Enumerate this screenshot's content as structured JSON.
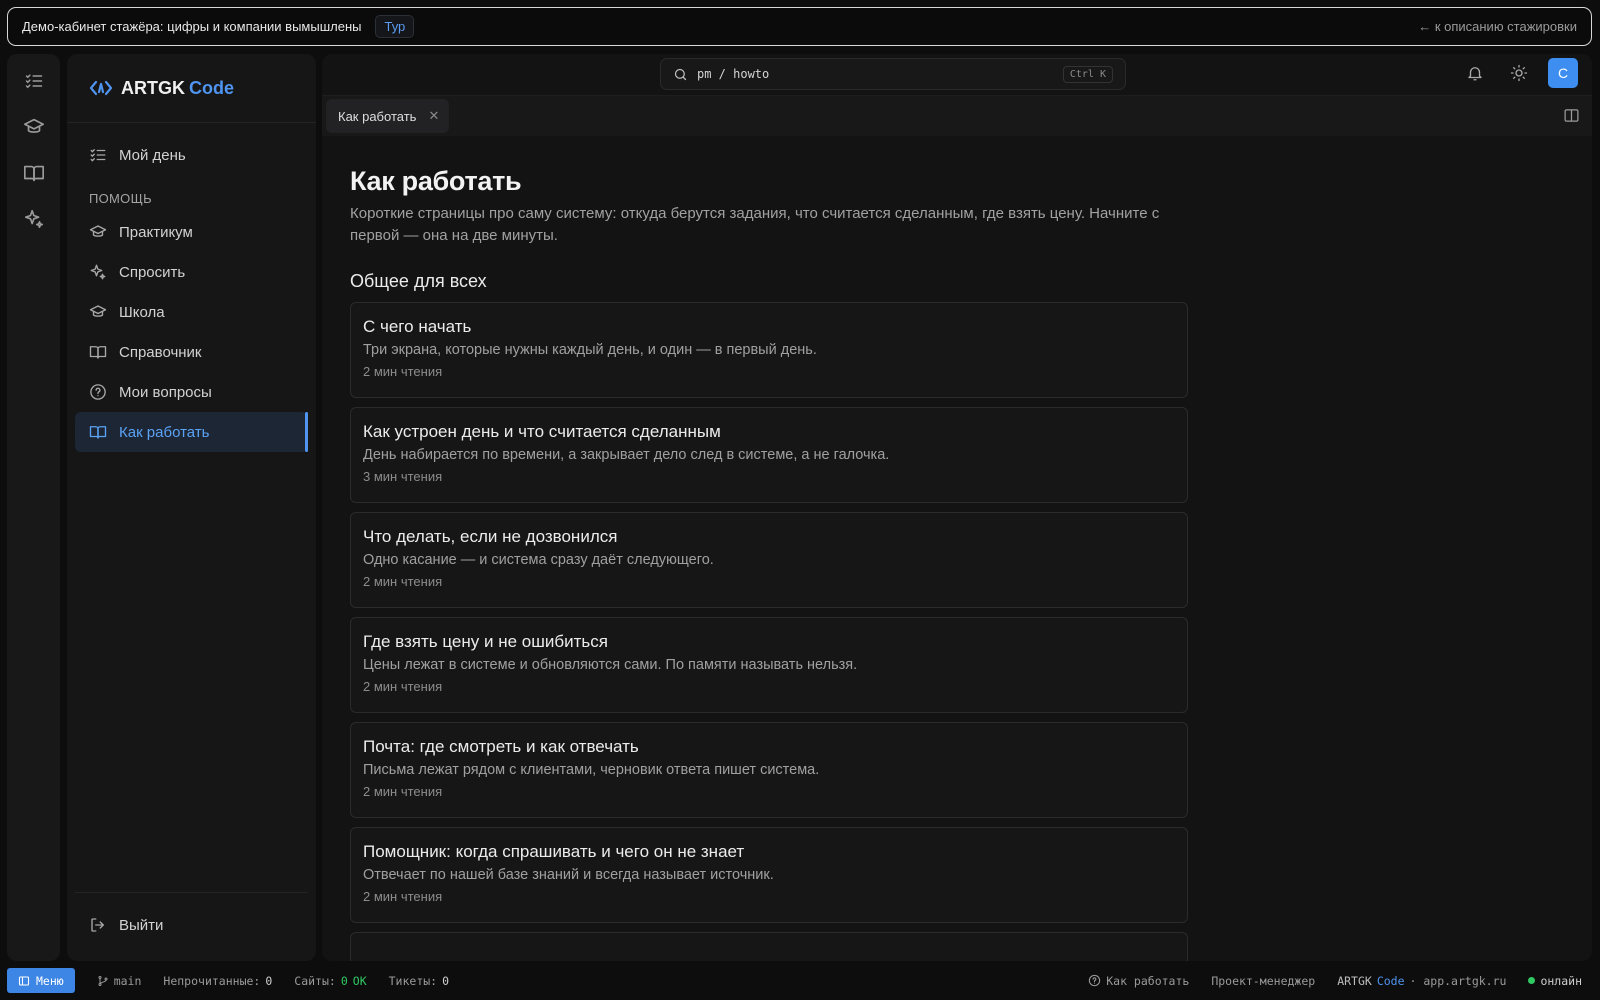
{
  "banner": {
    "text": "Демо-кабинет стажёра: цифры и компании вымышлены",
    "tour_label": "Тур",
    "back_link": "← к описанию стажировки"
  },
  "brand": {
    "name": "ARTGK",
    "name_accent": "Code"
  },
  "sidebar": {
    "top_item": {
      "label": "Мой день",
      "icon": "checklist-icon"
    },
    "section_label": "ПОМОЩЬ",
    "items": [
      {
        "label": "Практикум",
        "icon": "graduation-cap-icon"
      },
      {
        "label": "Спросить",
        "icon": "sparkles-icon"
      },
      {
        "label": "Школа",
        "icon": "graduation-cap-icon"
      },
      {
        "label": "Справочник",
        "icon": "book-icon"
      },
      {
        "label": "Мои вопросы",
        "icon": "question-circle-icon"
      },
      {
        "label": "Как работать",
        "icon": "book-icon",
        "active": true
      }
    ],
    "logout_label": "Выйти"
  },
  "topbar": {
    "search_text": "pm / howto",
    "search_shortcut": "Ctrl K",
    "avatar_letter": "С"
  },
  "tabs": [
    {
      "label": "Как работать"
    }
  ],
  "page": {
    "title": "Как работать",
    "description": "Короткие страницы про саму систему: откуда берутся задания, что считается сделанным, где взять цену. Начните с первой — она на две минуты.",
    "group_title": "Общее для всех",
    "articles": [
      {
        "title": "С чего начать",
        "desc": "Три экрана, которые нужны каждый день, и один — в первый день.",
        "meta": "2 мин чтения"
      },
      {
        "title": "Как устроен день и что считается сделанным",
        "desc": "День набирается по времени, а закрывает дело след в системе, а не галочка.",
        "meta": "3 мин чтения"
      },
      {
        "title": "Что делать, если не дозвонился",
        "desc": "Одно касание — и система сразу даёт следующего.",
        "meta": "2 мин чтения"
      },
      {
        "title": "Где взять цену и не ошибиться",
        "desc": "Цены лежат в системе и обновляются сами. По памяти называть нельзя.",
        "meta": "2 мин чтения"
      },
      {
        "title": "Почта: где смотреть и как отвечать",
        "desc": "Письма лежат рядом с клиентами, черновик ответа пишет система.",
        "meta": "2 мин чтения"
      },
      {
        "title": "Помощник: когда спрашивать и чего он не знает",
        "desc": "Отвечает по нашей базе знаний и всегда называет источник.",
        "meta": "2 мин чтения"
      }
    ]
  },
  "statusbar": {
    "menu_label": "Меню",
    "branch": "main",
    "unread_label": "Непрочитанные:",
    "unread_value": "0",
    "sites_label": "Сайты:",
    "sites_value": "0",
    "sites_status": "OK",
    "tickets_label": "Тикеты:",
    "tickets_value": "0",
    "current_page": "Как работать",
    "role": "Проект-менеджер",
    "app_name": "ARTGK",
    "app_accent": "Code",
    "app_domain": "· app.artgk.ru",
    "online_label": "онлайн"
  },
  "colors": {
    "accent": "#4f94ef",
    "online": "#2fca61",
    "avatar": "#3d8ef0"
  }
}
